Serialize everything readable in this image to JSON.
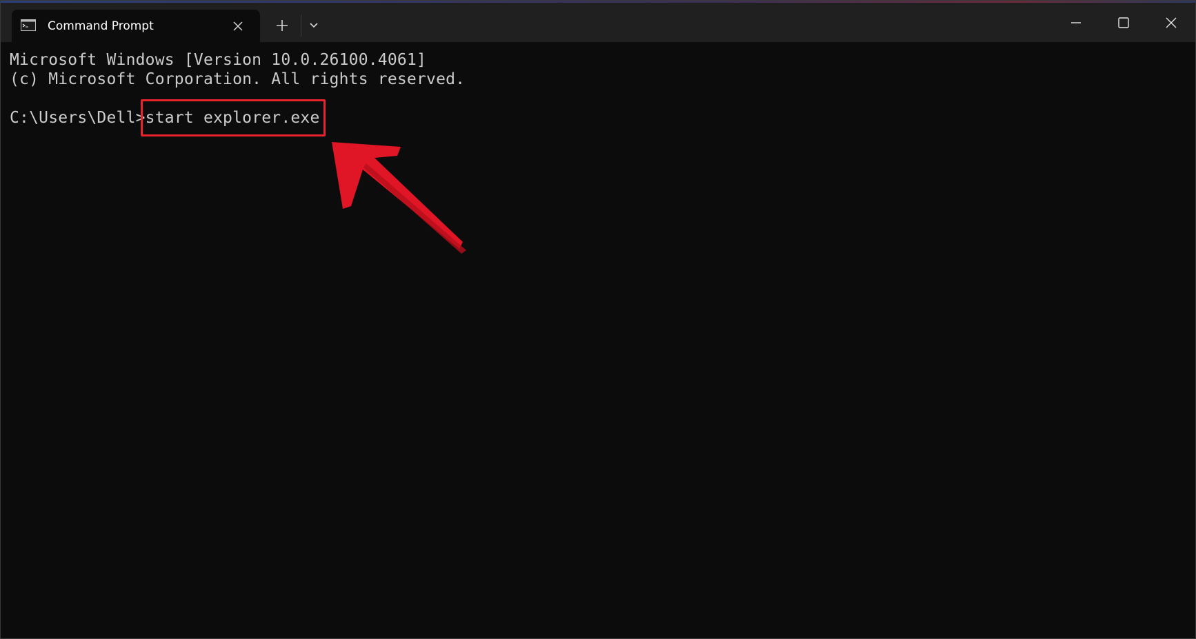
{
  "window": {
    "tab_title": "Command Prompt",
    "icons": {
      "tab": "terminal-icon",
      "tab_close": "close-icon",
      "new_tab": "plus-icon",
      "dropdown": "chevron-down-icon",
      "minimize": "minimize-icon",
      "maximize": "maximize-icon",
      "close": "close-icon"
    }
  },
  "terminal": {
    "lines": [
      "Microsoft Windows [Version 10.0.26100.4061]",
      "(c) Microsoft Corporation. All rights reserved.",
      ""
    ],
    "prompt": "C:\\Users\\Dell>",
    "command": "start explorer.exe"
  },
  "annotation": {
    "highlight_color": "#e8242f",
    "arrow_color": "#e01525"
  }
}
